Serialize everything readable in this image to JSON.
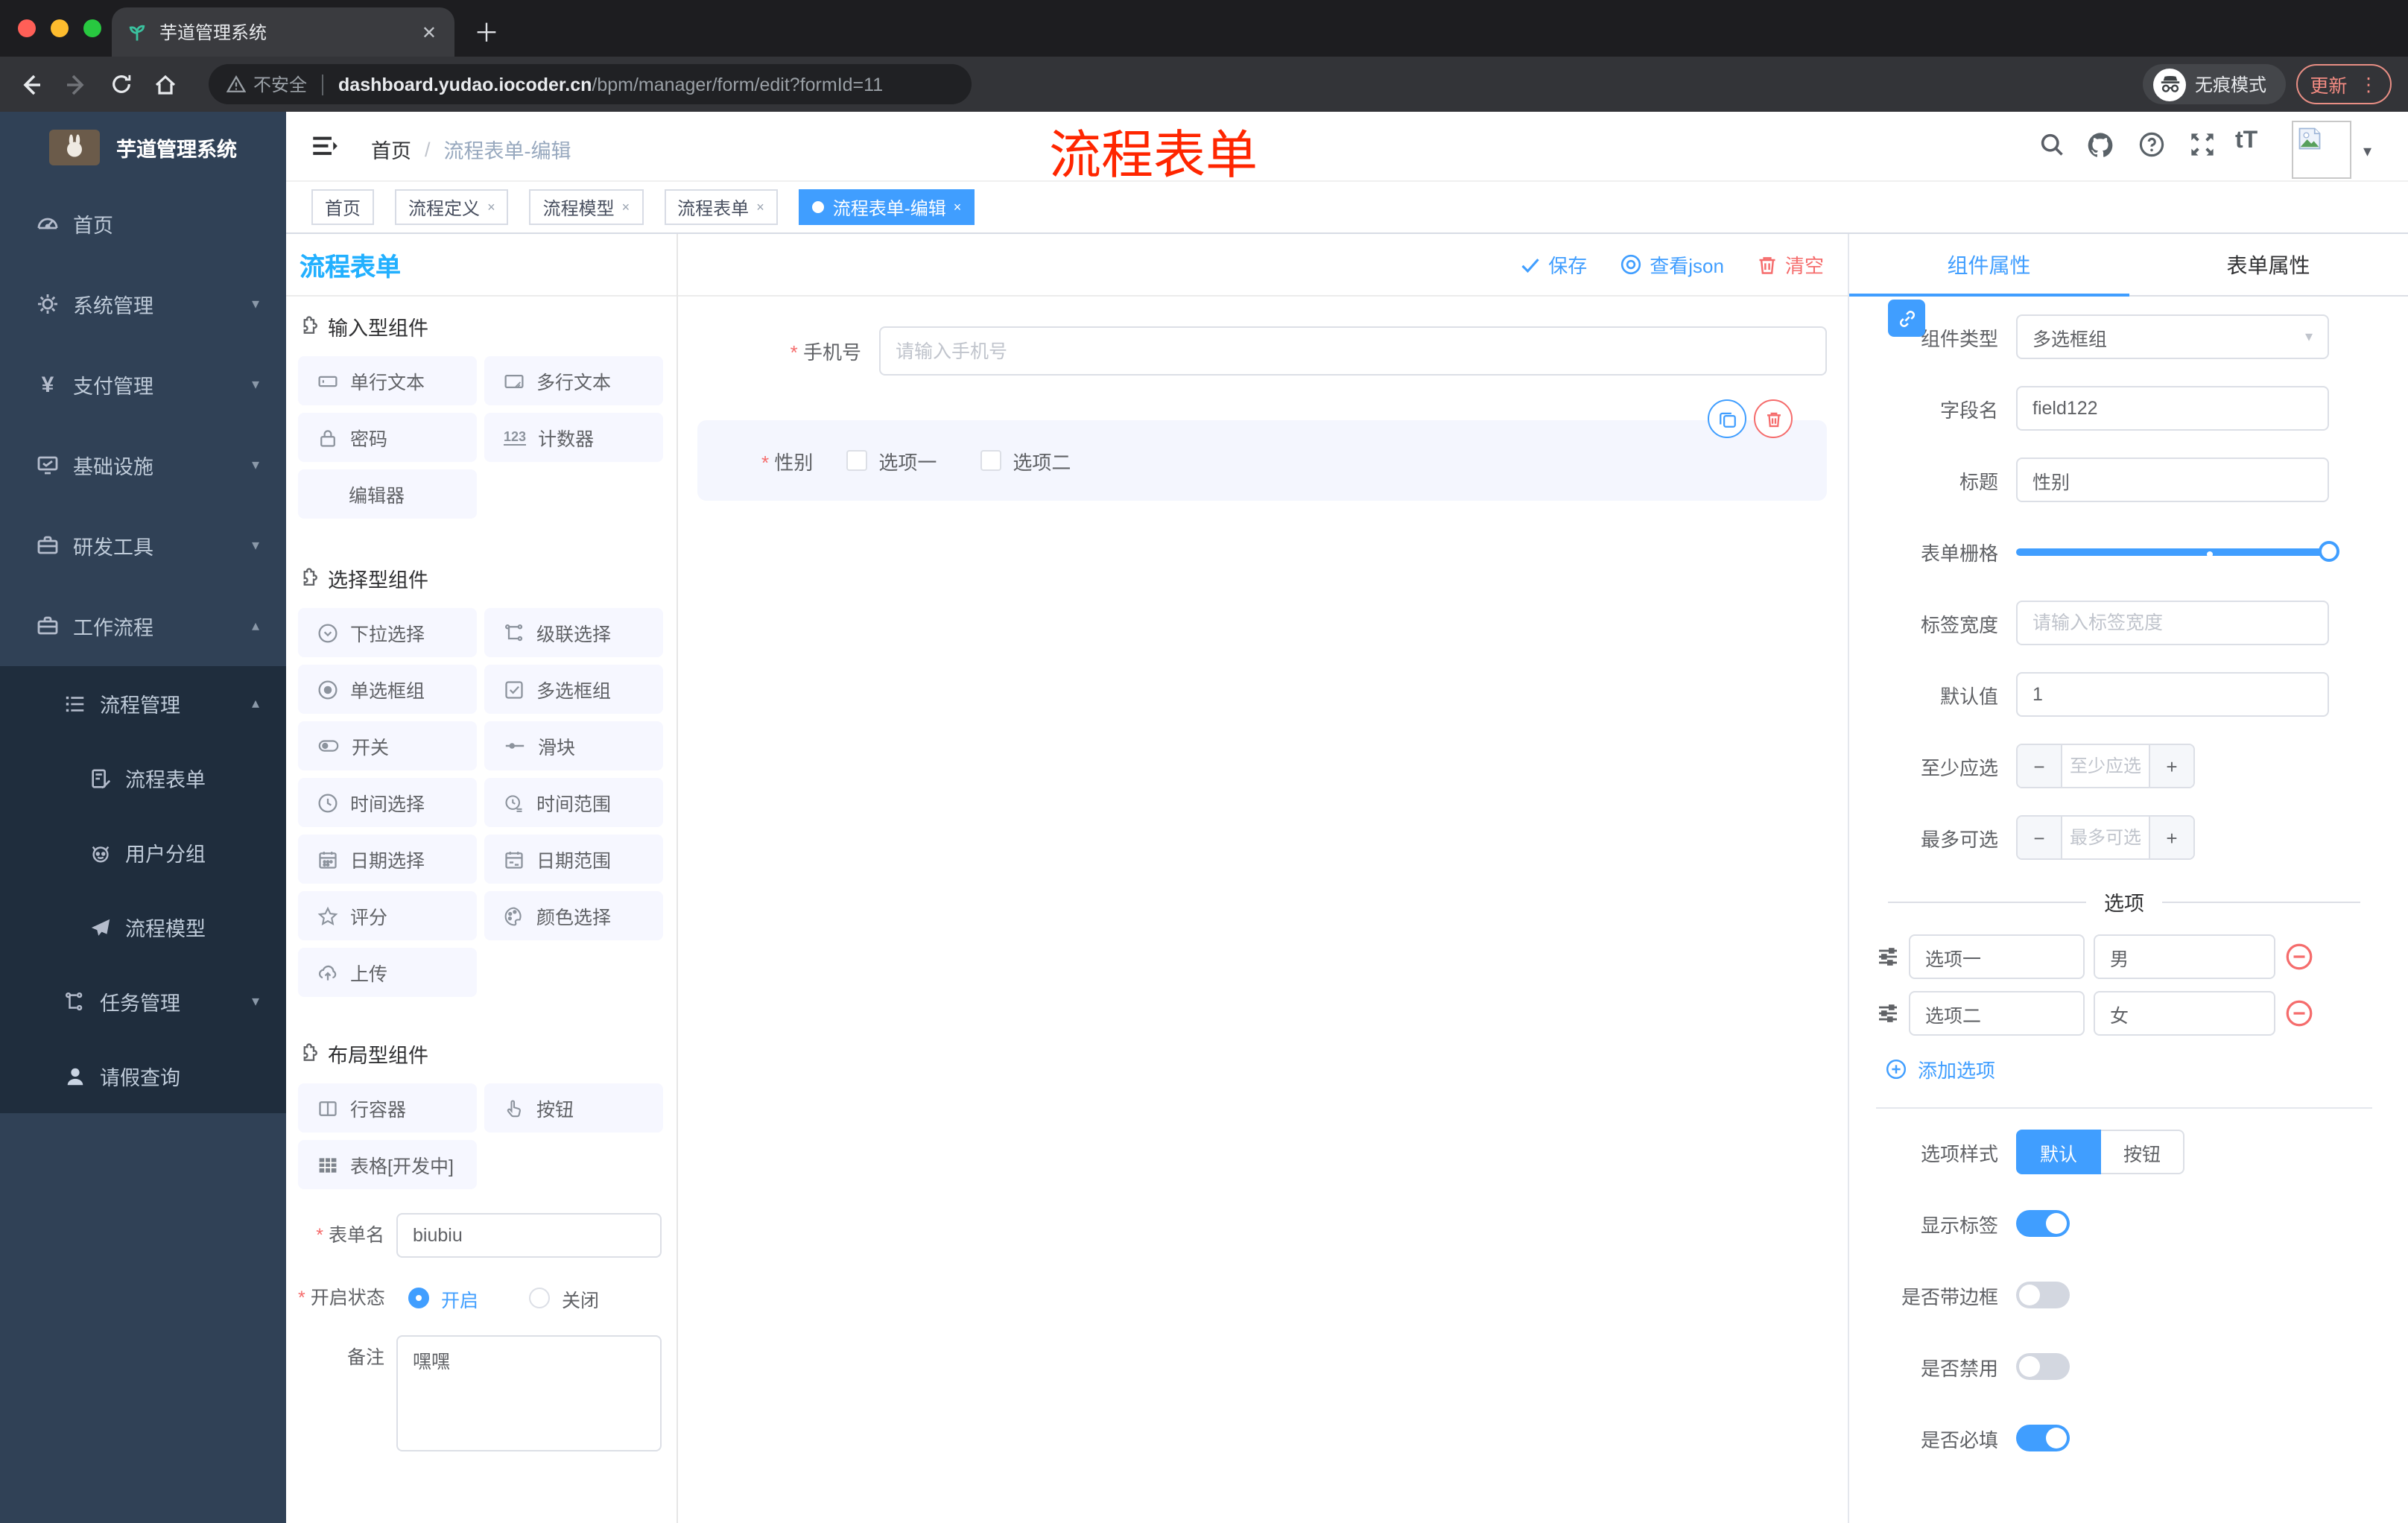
{
  "icons": {
    "close": "✕",
    "new_tab": "＋",
    "kebab": "⋮",
    "caret": "▾",
    "slash": "/",
    "minus": "−",
    "plus": "+",
    "x": "×",
    "num123": "123",
    "yen": "¥",
    "question": "?",
    "tT": "tT"
  },
  "colors": {
    "accent": "#409eff",
    "danger": "#f56c6c",
    "panel_title": "#22b0ff",
    "overlay_red": "#ff2600",
    "sidebar_bg": "#304156",
    "submenu_bg": "#1f2d3d"
  },
  "browser": {
    "tab_title": "芋道管理系统",
    "security_label": "不安全",
    "url_domain": "dashboard.yudao.iocoder.cn",
    "url_path": "/bpm/manager/form/edit?formId=11",
    "incognito_label": "无痕模式",
    "update_label": "更新"
  },
  "sidebar": {
    "logo_title": "芋道管理系统",
    "items": [
      {
        "label": "首页"
      },
      {
        "label": "系统管理"
      },
      {
        "label": "支付管理"
      },
      {
        "label": "基础设施"
      },
      {
        "label": "研发工具"
      },
      {
        "label": "工作流程"
      },
      {
        "label": "流程管理"
      },
      {
        "label": "流程表单"
      },
      {
        "label": "用户分组"
      },
      {
        "label": "流程模型"
      },
      {
        "label": "任务管理"
      },
      {
        "label": "请假查询"
      }
    ]
  },
  "header": {
    "breadcrumb_home": "首页",
    "breadcrumb_current": "流程表单-编辑",
    "overlay_text": "流程表单"
  },
  "tags": [
    {
      "label": "首页"
    },
    {
      "label": "流程定义"
    },
    {
      "label": "流程模型"
    },
    {
      "label": "流程表单"
    },
    {
      "label": "流程表单-编辑"
    }
  ],
  "designer": {
    "panel_title": "流程表单",
    "toolbar": {
      "save": "保存",
      "view_json": "查看json",
      "clear": "清空"
    },
    "groups": [
      {
        "title": "输入型组件",
        "items": [
          "单行文本",
          "多行文本",
          "密码",
          "计数器",
          "编辑器"
        ]
      },
      {
        "title": "选择型组件",
        "items": [
          "下拉选择",
          "级联选择",
          "单选框组",
          "多选框组",
          "开关",
          "滑块",
          "时间选择",
          "时间范围",
          "日期选择",
          "日期范围",
          "评分",
          "颜色选择",
          "上传"
        ]
      },
      {
        "title": "布局型组件",
        "items": [
          "行容器",
          "按钮",
          "表格[开发中]"
        ]
      }
    ],
    "meta": {
      "name_label": "表单名",
      "name_value": "biubiu",
      "status_label": "开启状态",
      "status_on": "开启",
      "status_off": "关闭",
      "remark_label": "备注",
      "remark_value": "嘿嘿"
    }
  },
  "canvas": {
    "phone_label": "手机号",
    "phone_placeholder": "请输入手机号",
    "gender_label": "性别",
    "gender_option1": "选项一",
    "gender_option2": "选项二"
  },
  "props": {
    "tab_component": "组件属性",
    "tab_form": "表单属性",
    "type_label": "组件类型",
    "type_value": "多选框组",
    "field_label": "字段名",
    "field_value": "field122",
    "title_label": "标题",
    "title_value": "性别",
    "grid_label": "表单栅格",
    "label_width_label": "标签宽度",
    "label_width_placeholder": "请输入标签宽度",
    "default_label": "默认值",
    "default_value": "1",
    "min_label": "至少应选",
    "min_placeholder": "至少应选",
    "max_label": "最多可选",
    "max_placeholder": "最多可选",
    "options_title": "选项",
    "options": [
      {
        "label": "选项一",
        "value": "男"
      },
      {
        "label": "选项二",
        "value": "女"
      }
    ],
    "add_option_label": "添加选项",
    "style_label": "选项样式",
    "style_default": "默认",
    "style_button": "按钮",
    "toggle_show_label": "显示标签",
    "toggle_border_label": "是否带边框",
    "toggle_disabled_label": "是否禁用",
    "toggle_required_label": "是否必填"
  }
}
